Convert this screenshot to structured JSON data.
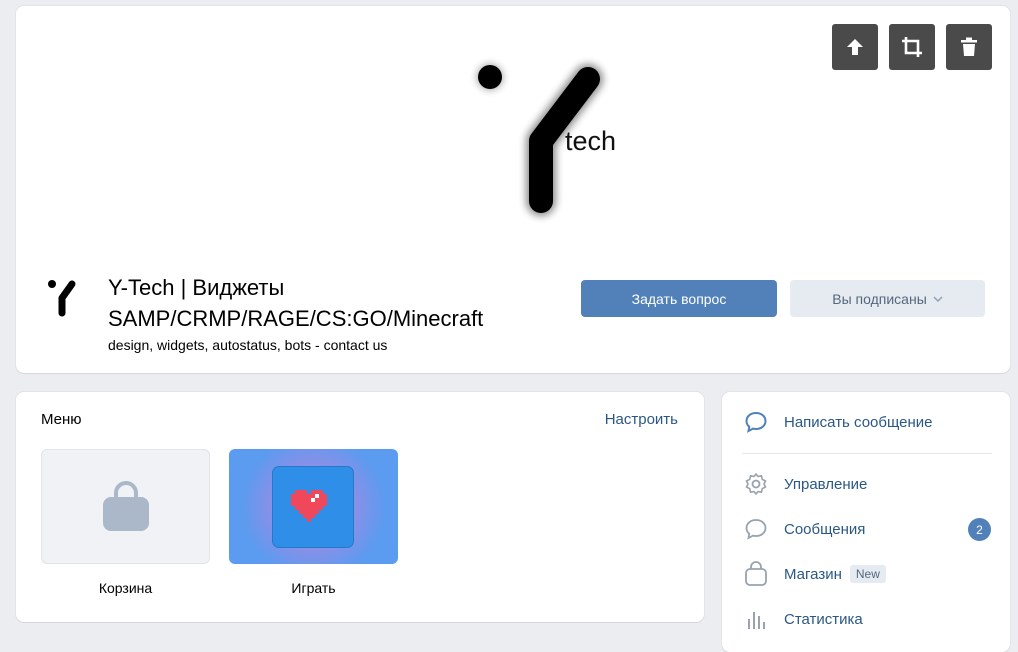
{
  "header": {
    "cover_logo_text": "tech",
    "group_title": "Y-Tech | Виджеты SAMP/CRMP/RAGE/CS:GO/Minecraft",
    "group_status": "design, widgets, autostatus, bots - contact us",
    "ask_button": "Задать вопрос",
    "subscribed_button": "Вы подписаны",
    "cover_actions": [
      "upload-icon",
      "crop-icon",
      "trash-icon"
    ]
  },
  "menu": {
    "title": "Меню",
    "configure": "Настроить",
    "tiles": [
      {
        "label": "Корзина",
        "icon": "shopping-bag-icon"
      },
      {
        "label": "Играть",
        "icon": "pixel-heart-icon"
      }
    ]
  },
  "side": {
    "write_message": "Написать сообщение",
    "items": [
      {
        "label": "Управление",
        "icon": "gear-icon"
      },
      {
        "label": "Сообщения",
        "icon": "chat-bubble-icon",
        "badge": "2"
      },
      {
        "label": "Магазин",
        "icon": "shopping-bag-icon",
        "tag": "New"
      },
      {
        "label": "Статистика",
        "icon": "bar-chart-icon"
      }
    ]
  },
  "colors": {
    "accent": "#5181b8",
    "link": "#2a5885",
    "background": "#ebedf0"
  }
}
